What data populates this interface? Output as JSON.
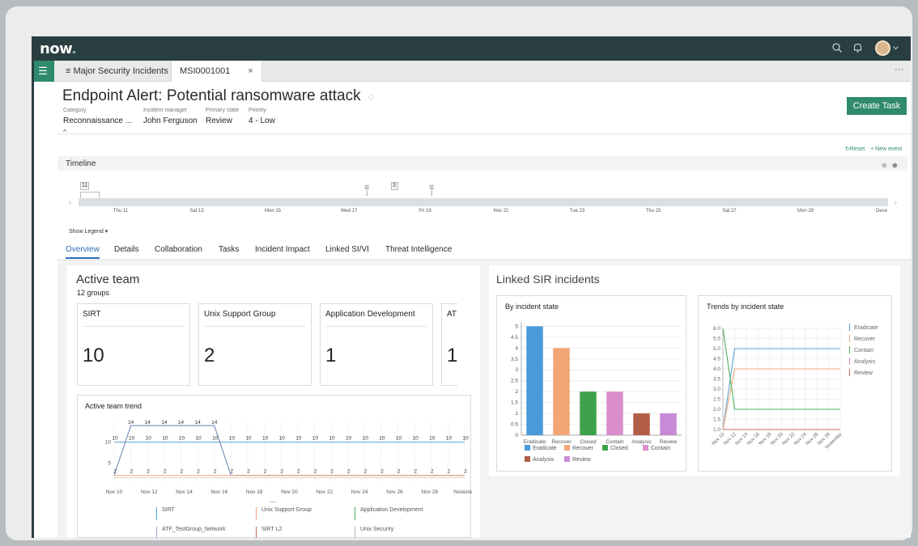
{
  "app": {
    "logo": "now",
    "colors": {
      "topbar": "#293e40",
      "accent": "#2f8a6e",
      "link": "#2f6fb5"
    }
  },
  "icons": {
    "search": "search-icon",
    "bell": "bell-icon",
    "menu": "list-menu-icon",
    "tag": "tag-icon",
    "collapse": "chevron-up-icon"
  },
  "tabs": [
    {
      "label": "≡ Major Security Incidents"
    },
    {
      "label": "MSI0001001",
      "close": "×"
    }
  ],
  "tab_more": "···",
  "record": {
    "title": "Endpoint Alert: Potential ransomware attack",
    "fields": [
      {
        "label": "Category",
        "value": "Reconnaissance ..."
      },
      {
        "label": "Incident manager",
        "value": "John Ferguson"
      },
      {
        "label": "Primary state",
        "value": "Review"
      },
      {
        "label": "Priority",
        "value": "4 - Low"
      }
    ],
    "create_task": "Create Task",
    "collapse": "^"
  },
  "timeline": {
    "label": "Timeline",
    "reset": "Reset",
    "new_event": "+ New event",
    "show_legend": "Show Legend ▾",
    "markers": [
      {
        "text": "11"
      },
      {
        "text": "3"
      }
    ],
    "dates": [
      "Thu 11",
      "Sat 13",
      "Mon 15",
      "Wed 17",
      "Fri 19",
      "Nov 21",
      "Tue 23",
      "Thu 25",
      "Sat 27",
      "Mon 29",
      "Dece"
    ]
  },
  "subtabs": [
    "Overview",
    "Details",
    "Collaboration",
    "Tasks",
    "Incident Impact",
    "Linked SI/VI",
    "Threat Intelligence"
  ],
  "active_team": {
    "title": "Active team",
    "groups": "12 groups",
    "cards": [
      {
        "name": "SIRT",
        "value": "10"
      },
      {
        "name": "Unix Support Group",
        "value": "2"
      },
      {
        "name": "Application Development",
        "value": "1"
      },
      {
        "name": "AT",
        "value": "1"
      }
    ],
    "trend_title": "Active team trend",
    "trend_legend": [
      {
        "name": "SIRT",
        "color": "#5aa5d8"
      },
      {
        "name": "Unix Support Group",
        "color": "#f3a37a"
      },
      {
        "name": "Application Development",
        "color": "#52ad5b"
      },
      {
        "name": "ATF_TestGroup_Network",
        "color": "#9aa3c9"
      },
      {
        "name": "SIRT L2",
        "color": "#c56a5b"
      },
      {
        "name": "Unix Security",
        "color": "#b9b9b9"
      }
    ],
    "trend_dash": "—"
  },
  "linked_sir": {
    "title": "Linked SIR incidents"
  },
  "chart_data": [
    {
      "type": "bar",
      "title": "By incident state",
      "categories": [
        "Eradicate",
        "Recover",
        "Closed",
        "Contain",
        "Analysis",
        "Review"
      ],
      "values": [
        5,
        4,
        2,
        2,
        1,
        1
      ],
      "colors": [
        "#4a9ad9",
        "#f2a678",
        "#3fa24a",
        "#d98dcb",
        "#b25e46",
        "#c78ad6"
      ],
      "yticks": [
        "0",
        "0.5",
        "1",
        "1.5",
        "2",
        "2.5",
        "3",
        "3.5",
        "4",
        "4.5",
        "5"
      ],
      "ylim": [
        0,
        5.2
      ],
      "legend": [
        "Eradicate",
        "Recover",
        "Closed",
        "Contain",
        "Analysis",
        "Review"
      ],
      "legend_position": "bottom"
    },
    {
      "type": "line",
      "title": "Trends by incident state",
      "x": [
        "Nov 10",
        "Nov 12",
        "Nov 14",
        "Nov 16",
        "Nov 18",
        "Nov 20",
        "Nov 22",
        "Nov 24",
        "Nov 26",
        "Nov 28",
        "Yesterday"
      ],
      "yticks": [
        "1.0",
        "1.5",
        "2.0",
        "2.5",
        "3.0",
        "3.5",
        "4.0",
        "4.5",
        "5.0",
        "5.5",
        "6.0"
      ],
      "ylim": [
        1.0,
        6.0
      ],
      "series": [
        {
          "name": "Eradicate",
          "color": "#5aa5d8",
          "values": [
            1,
            5,
            5,
            5,
            5,
            5,
            5,
            5,
            5,
            5,
            5
          ]
        },
        {
          "name": "Recover",
          "color": "#f2a678",
          "values": [
            1,
            4,
            4,
            4,
            4,
            4,
            4,
            4,
            4,
            4,
            4
          ]
        },
        {
          "name": "Contain",
          "color": "#52ad5b",
          "values": [
            6,
            2,
            2,
            2,
            2,
            2,
            2,
            2,
            2,
            2,
            2
          ]
        },
        {
          "name": "Analysis",
          "color": "#d98dcb",
          "values": [
            1,
            1,
            1,
            1,
            1,
            1,
            1,
            1,
            1,
            1,
            1
          ]
        },
        {
          "name": "Review",
          "color": "#c56a5b",
          "values": [
            1,
            1,
            1,
            1,
            1,
            1,
            1,
            1,
            1,
            1,
            1
          ]
        }
      ],
      "legend_position": "right"
    },
    {
      "type": "line",
      "title": "Active team trend",
      "x": [
        "Nov 10",
        "Nov 12",
        "Nov 14",
        "Nov 16",
        "Nov 18",
        "Nov 20",
        "Nov 22",
        "Nov 24",
        "Nov 26",
        "Nov 28",
        "Yesterday"
      ],
      "yticks": [
        "5",
        "10"
      ],
      "ylim": [
        0,
        15
      ],
      "series": [
        {
          "name": "SIRT",
          "color": "#5aa5d8",
          "values": [
            10,
            10,
            10,
            10,
            10,
            10,
            10,
            10,
            10,
            10,
            10,
            10,
            10,
            10,
            10,
            10,
            10,
            10,
            10,
            10,
            10,
            10
          ]
        },
        {
          "name": "SIRT L2",
          "color": "#5f7fb8",
          "values": [
            2,
            14,
            14,
            14,
            14,
            14,
            14,
            2,
            2,
            2,
            2,
            2,
            2,
            2,
            2,
            2,
            2,
            2,
            2,
            2,
            2,
            2
          ]
        },
        {
          "name": "Unix Support Group",
          "color": "#f3a37a",
          "values": [
            2,
            2,
            2,
            2,
            2,
            2,
            2,
            2,
            2,
            2,
            2,
            2,
            2,
            2,
            2,
            2,
            2,
            2,
            2,
            2,
            2,
            2
          ]
        }
      ],
      "labels_sirt": [
        "10",
        "10",
        "10",
        "10",
        "10",
        "10",
        "10",
        "10",
        "10",
        "10",
        "10",
        "10",
        "10",
        "10",
        "10",
        "10",
        "10",
        "10",
        "10",
        "10",
        "10",
        "10"
      ],
      "labels_peak": [
        "14",
        "14",
        "14",
        "14",
        "14",
        "14"
      ],
      "labels_low": [
        "2",
        "2",
        "2",
        "2",
        "2",
        "2",
        "2",
        "2",
        "2",
        "2",
        "2",
        "2",
        "2",
        "2",
        "2",
        "2",
        "2",
        "2",
        "2",
        "2",
        "2",
        "2"
      ]
    }
  ]
}
